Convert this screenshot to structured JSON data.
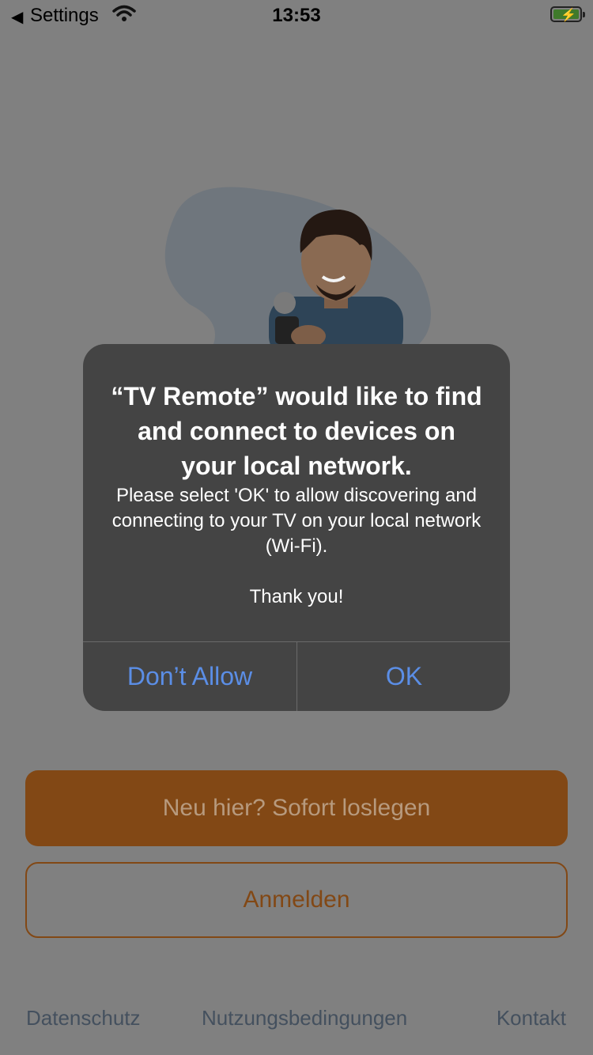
{
  "status_bar": {
    "back_app": "Settings",
    "time": "13:53"
  },
  "dialog": {
    "title": "“TV Remote” would like to find and connect to devices on your local network.",
    "message": "Please select 'OK' to allow discovering and connecting to your TV on your local network (Wi-Fi).\n\nThank you!",
    "deny_label": "Don’t Allow",
    "ok_label": "OK",
    "button_color": "#5b8ee6"
  },
  "main": {
    "primary_button_label": "Neu hier? Sofort loslegen",
    "secondary_button_label": "Anmelden",
    "accent_color": "#824815"
  },
  "footer": {
    "links": [
      "Datenschutz",
      "Nutzungsbedingungen",
      "Kontakt"
    ]
  }
}
